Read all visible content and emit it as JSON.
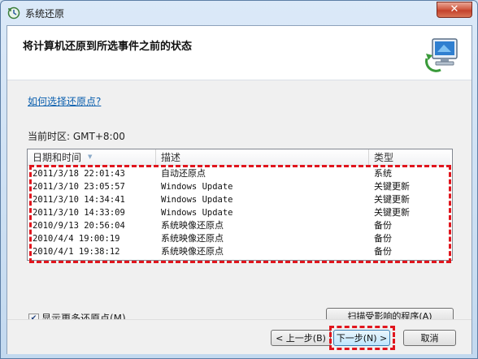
{
  "window": {
    "title": "系统还原",
    "close_label": "✕"
  },
  "header": {
    "title": "将计算机还原到所选事件之前的状态"
  },
  "help_link": "如何选择还原点?",
  "timezone": "当前时区: GMT+8:00",
  "list": {
    "columns": [
      "日期和时间",
      "描述",
      "类型"
    ],
    "rows": [
      {
        "datetime": "2011/3/18 22:01:43",
        "description": "自动还原点",
        "type": "系统"
      },
      {
        "datetime": "2011/3/10 23:05:57",
        "description": "Windows Update",
        "type": "关键更新"
      },
      {
        "datetime": "2011/3/10 14:34:41",
        "description": "Windows Update",
        "type": "关键更新"
      },
      {
        "datetime": "2011/3/10 14:33:09",
        "description": "Windows Update",
        "type": "关键更新"
      },
      {
        "datetime": "2010/9/13 20:56:04",
        "description": "系统映像还原点",
        "type": "备份"
      },
      {
        "datetime": "2010/4/4 19:00:19",
        "description": "系统映像还原点",
        "type": "备份"
      },
      {
        "datetime": "2010/4/1 19:38:12",
        "description": "系统映像还原点",
        "type": "备份"
      }
    ]
  },
  "show_more": {
    "label": "显示更多还原点(M)",
    "checked": true
  },
  "scan_button": "扫描受影响的程序(A)",
  "footer": {
    "back": "< 上一步(B)",
    "next": "下一步(N) >",
    "cancel": "取消"
  },
  "colors": {
    "highlight_dash": "#e0151d",
    "link": "#0b5fae"
  }
}
